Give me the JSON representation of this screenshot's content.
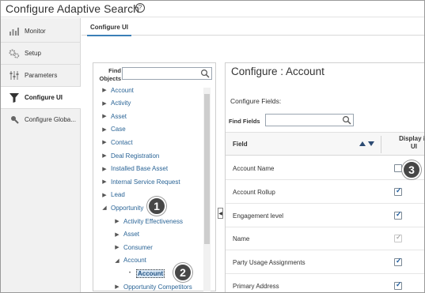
{
  "app": {
    "title": "Configure Adaptive Search",
    "help_glyph": "?"
  },
  "nav": {
    "items": [
      {
        "label": "Monitor",
        "icon": "bar-chart-icon",
        "active": false
      },
      {
        "label": "Setup",
        "icon": "gears-icon",
        "active": false
      },
      {
        "label": "Parameters",
        "icon": "sliders-icon",
        "active": false
      },
      {
        "label": "Configure UI",
        "icon": "funnel-icon",
        "active": true
      },
      {
        "label": "Configure Globa...",
        "icon": "magnifier-icon",
        "active": false
      }
    ]
  },
  "tabs": [
    {
      "label": "Configure UI",
      "active": true
    }
  ],
  "objects_panel": {
    "find_label_line1": "Find",
    "find_label_line2": "Objects",
    "find_value": "",
    "tree": [
      {
        "label": "Account",
        "level": 0,
        "state": "collapsed"
      },
      {
        "label": "Activity",
        "level": 0,
        "state": "collapsed"
      },
      {
        "label": "Asset",
        "level": 0,
        "state": "collapsed"
      },
      {
        "label": "Case",
        "level": 0,
        "state": "collapsed"
      },
      {
        "label": "Contact",
        "level": 0,
        "state": "collapsed"
      },
      {
        "label": "Deal Registration",
        "level": 0,
        "state": "collapsed"
      },
      {
        "label": "Installed Base Asset",
        "level": 0,
        "state": "collapsed"
      },
      {
        "label": "Internal Service Request",
        "level": 0,
        "state": "collapsed"
      },
      {
        "label": "Lead",
        "level": 0,
        "state": "collapsed"
      },
      {
        "label": "Opportunity",
        "level": 0,
        "state": "expanded"
      },
      {
        "label": "Activity Effectiveness",
        "level": 1,
        "state": "collapsed"
      },
      {
        "label": "Asset",
        "level": 1,
        "state": "collapsed"
      },
      {
        "label": "Consumer",
        "level": 1,
        "state": "collapsed"
      },
      {
        "label": "Account",
        "level": 1,
        "state": "expanded"
      },
      {
        "label": "Account",
        "level": 2,
        "state": "leaf",
        "selected": true
      },
      {
        "label": "Opportunity Competitors",
        "level": 1,
        "state": "collapsed"
      }
    ]
  },
  "configure_panel": {
    "title": "Configure : Account",
    "subtitle": "Configure Fields:",
    "find_fields_label": "Find Fields",
    "find_fields_value": "",
    "columns": {
      "field": "Field",
      "display_line1": "Display in",
      "display_line2": "UI"
    },
    "rows": [
      {
        "field": "Account Name",
        "checked": false,
        "disabled": false
      },
      {
        "field": "Account Rollup",
        "checked": true,
        "disabled": false
      },
      {
        "field": "Engagement level",
        "checked": true,
        "disabled": false
      },
      {
        "field": "Name",
        "checked": true,
        "disabled": true
      },
      {
        "field": "Party Usage Assignments",
        "checked": true,
        "disabled": false
      },
      {
        "field": "Primary Address",
        "checked": true,
        "disabled": false
      }
    ]
  },
  "callouts": [
    "1",
    "2",
    "3"
  ],
  "splitter_glyph": "◀",
  "colors": {
    "link": "#2a6496",
    "accent": "#3b7fb7",
    "callout": "#474747"
  }
}
